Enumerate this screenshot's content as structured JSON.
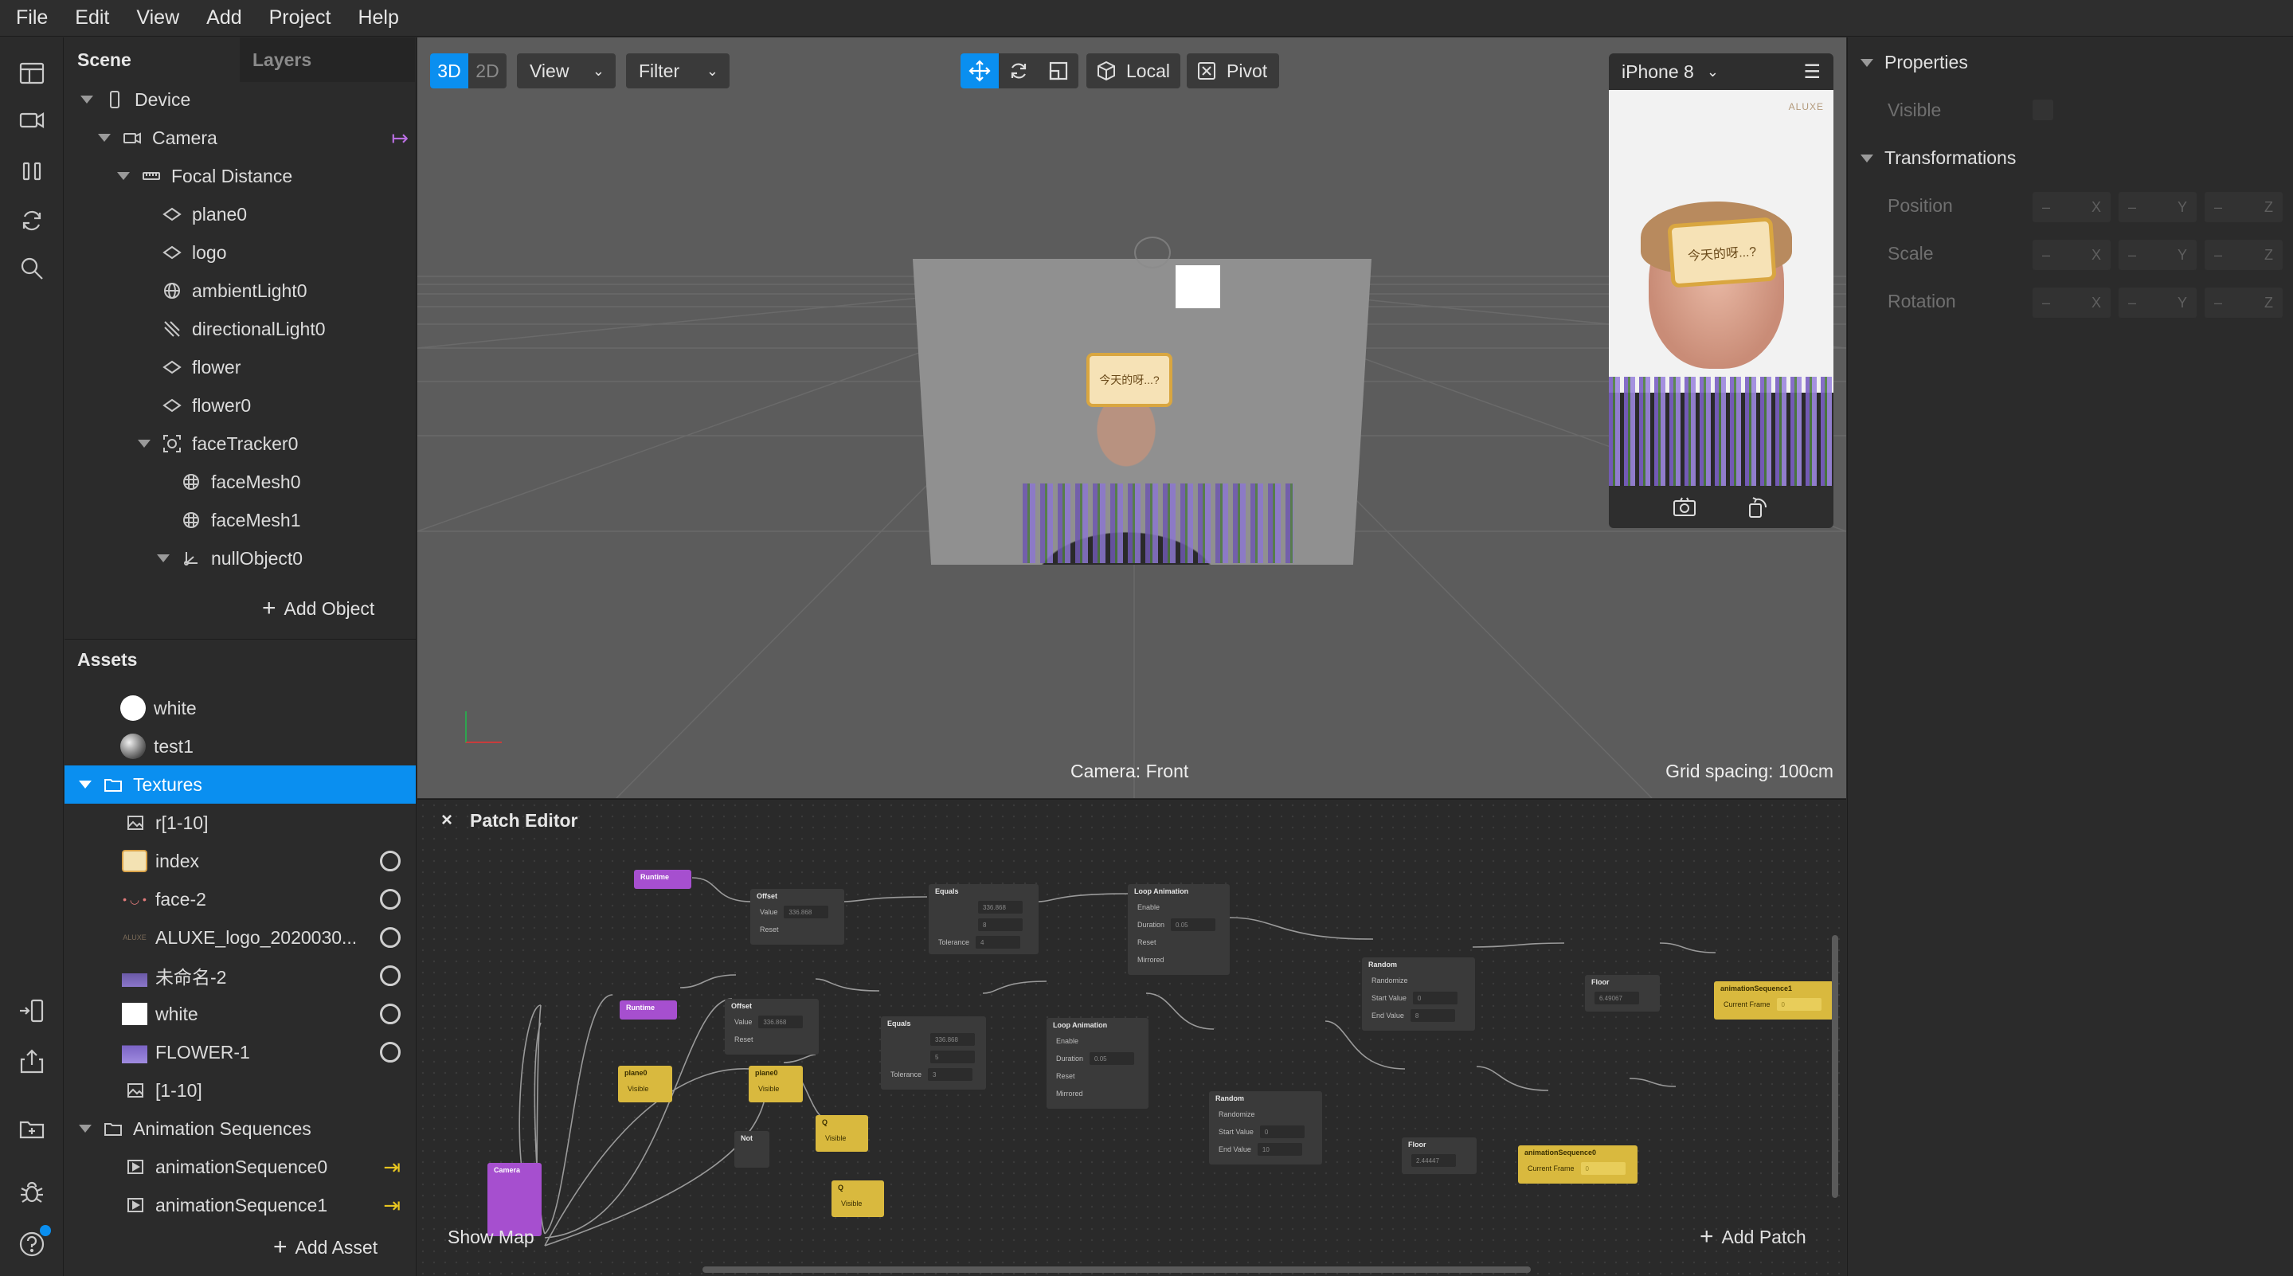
{
  "menu": [
    "File",
    "Edit",
    "View",
    "Add",
    "Project",
    "Help"
  ],
  "scene": {
    "tabs": [
      "Scene",
      "Layers"
    ],
    "items": [
      {
        "label": "Device",
        "icon": "device-icon"
      },
      {
        "label": "Camera",
        "icon": "camera-icon"
      },
      {
        "label": "Focal Distance",
        "icon": "ruler-icon"
      },
      {
        "label": "plane0",
        "icon": "plane-icon"
      },
      {
        "label": "logo",
        "icon": "plane-icon"
      },
      {
        "label": "ambientLight0",
        "icon": "ambient-light-icon"
      },
      {
        "label": "directionalLight0",
        "icon": "directional-light-icon"
      },
      {
        "label": "flower",
        "icon": "plane-icon"
      },
      {
        "label": "flower0",
        "icon": "plane-icon"
      },
      {
        "label": "faceTracker0",
        "icon": "face-tracker-icon"
      },
      {
        "label": "faceMesh0",
        "icon": "face-mesh-icon"
      },
      {
        "label": "faceMesh1",
        "icon": "face-mesh-icon"
      },
      {
        "label": "nullObject0",
        "icon": "null-object-icon"
      }
    ],
    "add_object": "Add Object"
  },
  "assets": {
    "title": "Assets",
    "items": [
      {
        "label": "white",
        "icon": "material-white-icon"
      },
      {
        "label": "test1",
        "icon": "material-sphere-icon"
      },
      {
        "label": "Textures",
        "icon": "folder-icon"
      },
      {
        "label": "r[1-10]",
        "icon": "image-icon"
      },
      {
        "label": "index",
        "icon": "texture-thumb-icon"
      },
      {
        "label": "face-2",
        "icon": "texture-thumb-icon"
      },
      {
        "label": "ALUXE_logo_2020030...",
        "icon": "texture-thumb-icon"
      },
      {
        "label": "未命名-2",
        "icon": "texture-thumb-icon"
      },
      {
        "label": "white",
        "icon": "texture-white-icon"
      },
      {
        "label": "FLOWER-1",
        "icon": "texture-thumb-icon"
      },
      {
        "label": "[1-10]",
        "icon": "image-icon"
      },
      {
        "label": "Animation Sequences",
        "icon": "folder-icon"
      },
      {
        "label": "animationSequence0",
        "icon": "animation-sequence-icon"
      },
      {
        "label": "animationSequence1",
        "icon": "animation-sequence-icon"
      }
    ],
    "add_asset": "Add Asset"
  },
  "viewport": {
    "mode_3d": "3D",
    "mode_2d": "2D",
    "view_label": "View",
    "filter_label": "Filter",
    "local_label": "Local",
    "pivot_label": "Pivot",
    "camera_label": "Camera: Front",
    "grid_label": "Grid spacing: 100cm",
    "sticker_text": "今天的呀...?"
  },
  "phone": {
    "device": "iPhone 8",
    "brand": "ALUXE",
    "sticker_text": "今天的呀...?"
  },
  "properties": {
    "section_properties": "Properties",
    "visible_label": "Visible",
    "section_transformations": "Transformations",
    "position_label": "Position",
    "scale_label": "Scale",
    "rotation_label": "Rotation",
    "axes": [
      "X",
      "Y",
      "Z"
    ],
    "dash": "–"
  },
  "patch_editor": {
    "title": "Patch Editor",
    "show_map": "Show Map",
    "add_patch": "Add Patch",
    "nodes": {
      "runtime1": "Runtime",
      "runtime2": "Runtime",
      "offset": "Offset",
      "equals": "Equals",
      "loop_animation": "Loop Animation",
      "random": "Random",
      "floor": "Floor",
      "anim_seq1": "animationSequence1",
      "anim_seq0": "animationSequence0",
      "plane0": "plane0",
      "not": "Not",
      "q": "Q",
      "camera": "Camera",
      "value": "Value",
      "reset": "Reset",
      "tolerance": "Tolerance",
      "enable": "Enable",
      "duration": "Duration",
      "mirrored": "Mirrored",
      "randomize": "Randomize",
      "start_value": "Start Value",
      "end_value": "End Value",
      "current_frame": "Current Frame",
      "visible": "Visible",
      "v_336": "336.868",
      "v_8": "8",
      "v_5": "5",
      "v_4": "4",
      "v_3": "3",
      "v_005": "0.05",
      "v_0": "0",
      "v_10": "10",
      "v_floor1": "6.49067",
      "v_floor2": "2.44447",
      "v_zero": "0"
    }
  },
  "colors": {
    "accent": "#0a8ff0",
    "purple": "#a64fcf",
    "yellow": "#d9b93e",
    "selected_row": "#0a8ff0"
  }
}
